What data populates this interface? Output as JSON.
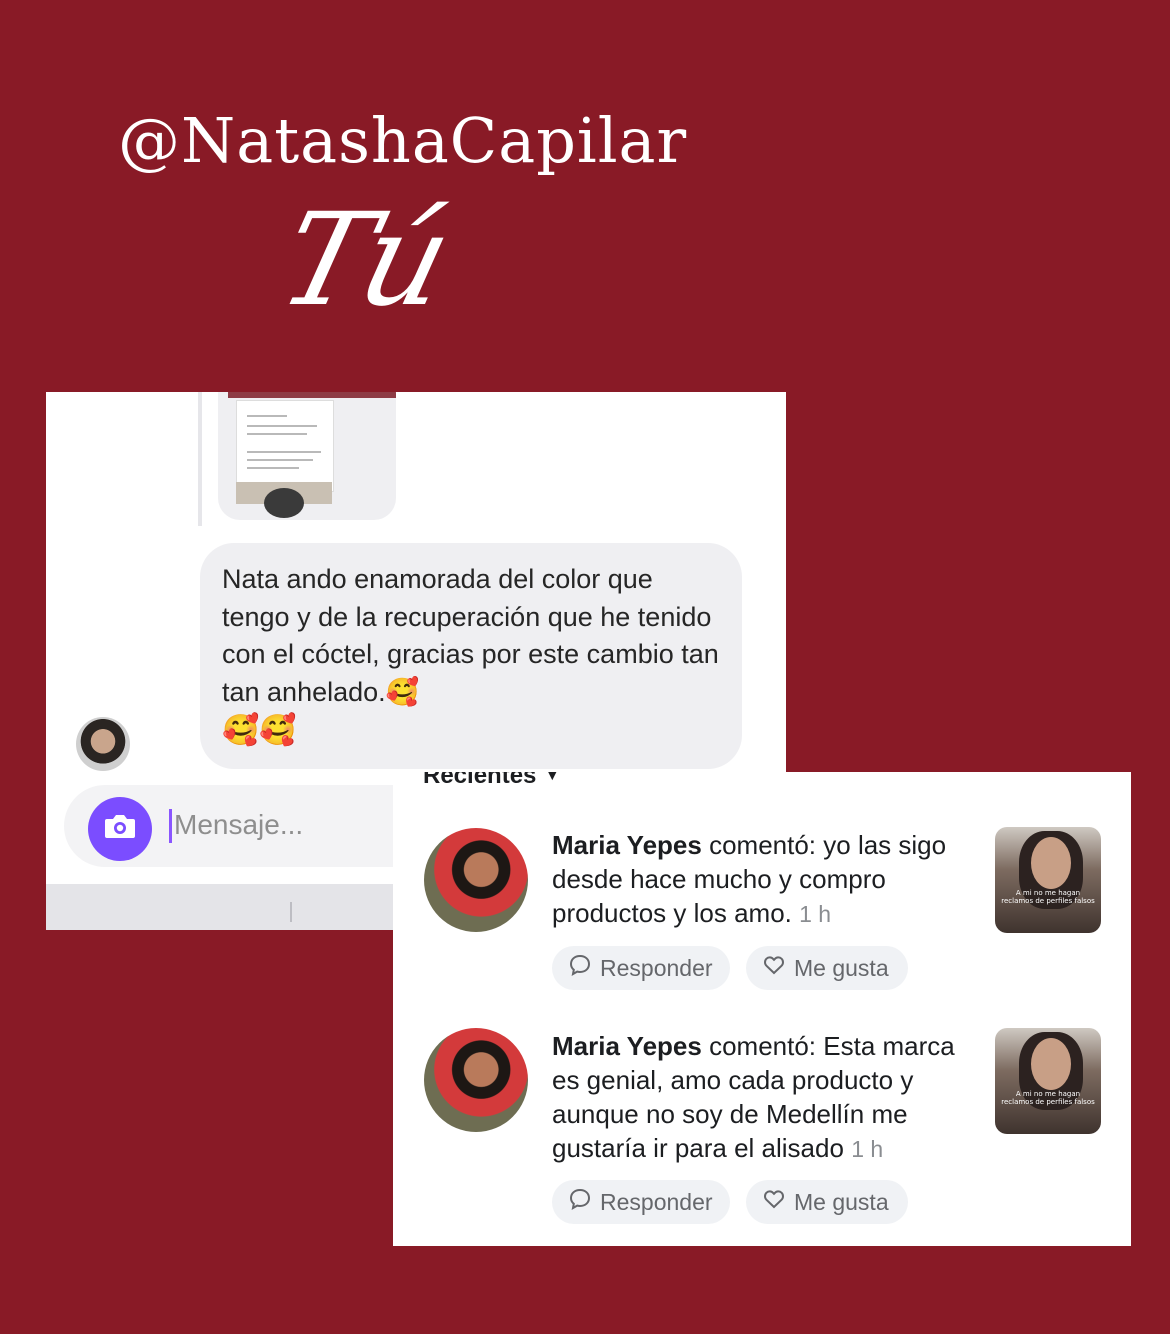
{
  "header": {
    "handle": "@NatashaCapilar",
    "script_title": "Tú"
  },
  "dm": {
    "message": "Nata ando enamorada del color que tengo y de la recuperación que he tenido con el cóctel, gracias por este cambio tan tan anhelado.🥰",
    "emojis": "🥰🥰",
    "composer_placeholder": "Mensaje..."
  },
  "comments_panel": {
    "sort_label": "Recientes",
    "comments": [
      {
        "author": "Maria Yepes",
        "verb": "comentó:",
        "text": "yo las sigo desde hace mucho y compro productos y los amo.",
        "time": "1 h",
        "thumb_caption": "A mi no me hagan reclamos de perfiles falsos",
        "reply_label": "Responder",
        "like_label": "Me gusta"
      },
      {
        "author": "Maria Yepes",
        "verb": "comentó:",
        "text": "Esta marca es genial, amo cada producto y aunque no soy de Medellín me gustaría ir para el alisado",
        "time": "1 h",
        "thumb_caption": "A mi no me hagan reclamos de perfiles falsos",
        "reply_label": "Responder",
        "like_label": "Me gusta"
      }
    ]
  },
  "colors": {
    "background": "#891a26",
    "composer_accent": "#7b4dff"
  }
}
